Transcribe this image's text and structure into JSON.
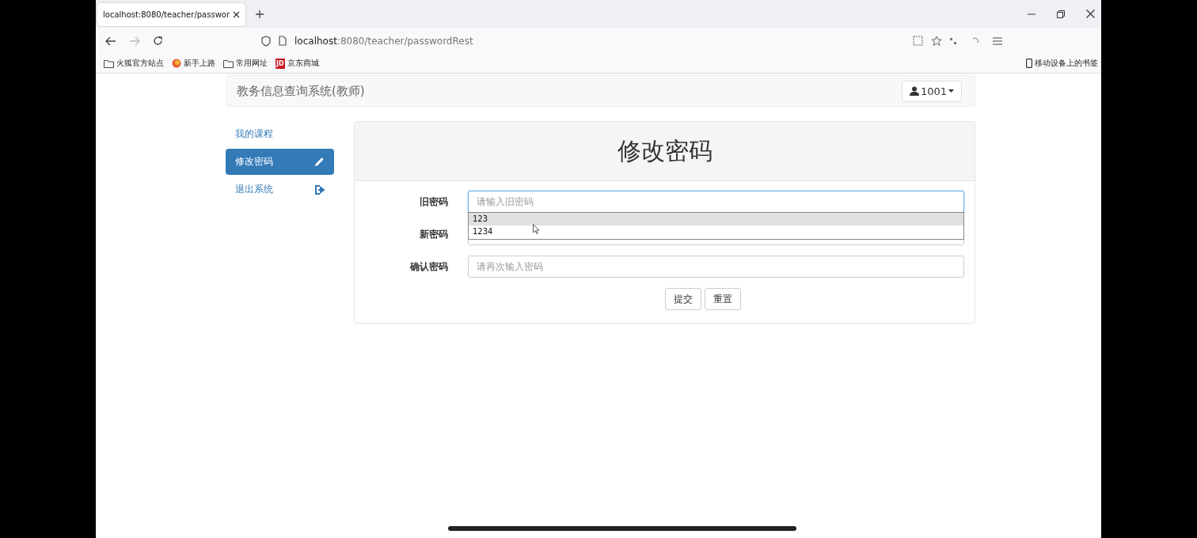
{
  "browser": {
    "tab": {
      "title": "localhost:8080/teacher/passwor",
      "selected": true
    },
    "address": {
      "host": "localhost",
      "path": ":8080/teacher/passwordRest"
    },
    "bookmarks": [
      {
        "label": "火狐官方站点",
        "kind": "folder"
      },
      {
        "label": "新手上路",
        "kind": "firefox"
      },
      {
        "label": "常用网址",
        "kind": "folder"
      },
      {
        "label": "京东商城",
        "kind": "jd",
        "badge": "JD"
      }
    ],
    "mobile_bookmarks": "移动设备上的书签"
  },
  "navbar": {
    "brand": "教务信息查询系统(教师)",
    "user": "1001"
  },
  "sidebar": {
    "items": [
      {
        "label": "我的课程",
        "selected": false,
        "kind": "plain"
      },
      {
        "label": "修改密码",
        "selected": true,
        "kind": "edit"
      },
      {
        "label": "退出系统",
        "selected": false,
        "kind": "exit"
      }
    ]
  },
  "panel": {
    "title": "修改密码",
    "fields": [
      {
        "label": "旧密码",
        "placeholder": "请输入旧密码",
        "focused": true
      },
      {
        "label": "新密码",
        "focused": false
      },
      {
        "label": "确认密码",
        "placeholder": "请再次输入密码",
        "focused": false
      }
    ],
    "autocomplete": [
      {
        "value": "123",
        "selected": true
      },
      {
        "value": "1234",
        "selected": false
      }
    ],
    "buttons": [
      "提交",
      "重置"
    ]
  }
}
